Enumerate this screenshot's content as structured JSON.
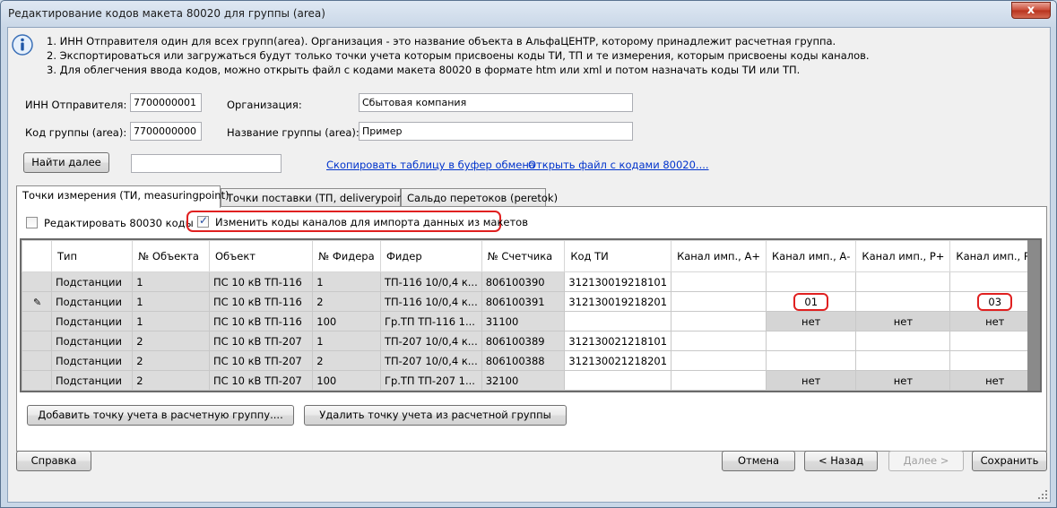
{
  "window": {
    "title": "Редактирование кодов макета 80020 для группы (area)",
    "close_glyph": "x"
  },
  "info": {
    "line1": "1. ИНН Отправителя один для всех групп(area). Организация - это название объекта в АльфаЦЕНТР, которому принадлежит расчетная группа.",
    "line2": "2. Экспортироваться или загружаться будут только точки учета которым присвоены коды ТИ, ТП и те измерения, которым присвоены коды каналов.",
    "line3": "3. Для облегчения ввода кодов, можно открыть файл с кодами макета 80020 в формате htm или xml и потом назначать коды ТИ или ТП."
  },
  "form": {
    "inn_label": "ИНН Отправителя:",
    "inn_value": "7700000001",
    "org_label": "Организация:",
    "org_value": "Сбытовая компания",
    "group_code_label": "Код группы (area):",
    "group_code_value": "7700000000",
    "group_name_label": "Название группы (area):",
    "group_name_value": "Пример",
    "find_next_label": "Найти далее",
    "find_value": "",
    "copy_link": "Скопировать таблицу в буфер обмена",
    "open_link": "Открыть файл с кодами 80020...."
  },
  "tabs": [
    {
      "label": "Точки измерения (ТИ, measuringpoint)",
      "active": true
    },
    {
      "label": "Точки поставки (ТП, deliverypoint)",
      "active": false
    },
    {
      "label": "Сальдо перетоков (peretok)",
      "active": false
    }
  ],
  "options": {
    "edit80030_label": "Редактировать 80030 коды",
    "edit80030_checked": false,
    "change_codes_label": "Изменить коды каналов для импорта данных из макетов",
    "change_codes_checked": true
  },
  "grid": {
    "columns": [
      "Тип",
      "№ Объекта",
      "Объект",
      "№ Фидера",
      "Фидер",
      "№ Счетчика",
      "Код ТИ",
      "Канал имп., А+",
      "Канал имп., А-",
      "Канал имп., Р+",
      "Канал имп., Р-"
    ],
    "editing_glyph": "✎",
    "rows": [
      {
        "editing": false,
        "cells": [
          "Подстанции",
          "1",
          "ПС 10 кВ ТП-116",
          "1",
          "ТП-116 10/0,4 к...",
          "806100390",
          "312130019218101",
          "",
          "",
          "",
          ""
        ]
      },
      {
        "editing": true,
        "cells": [
          "Подстанции",
          "1",
          "ПС 10 кВ ТП-116",
          "2",
          "ТП-116 10/0,4 к...",
          "806100391",
          "312130019218201",
          "",
          "01",
          "",
          "03"
        ]
      },
      {
        "editing": false,
        "cells": [
          "Подстанции",
          "1",
          "ПС 10 кВ ТП-116",
          "100",
          "Гр.ТП ТП-116 1...",
          "31100",
          "",
          "",
          "нет",
          "нет",
          "нет"
        ]
      },
      {
        "editing": false,
        "cells": [
          "Подстанции",
          "2",
          "ПС 10 кВ ТП-207",
          "1",
          "ТП-207 10/0,4 к...",
          "806100389",
          "312130021218101",
          "",
          "",
          "",
          ""
        ]
      },
      {
        "editing": false,
        "cells": [
          "Подстанции",
          "2",
          "ПС 10 кВ ТП-207",
          "2",
          "ТП-207 10/0,4 к...",
          "806100388",
          "312130021218201",
          "",
          "",
          "",
          ""
        ]
      },
      {
        "editing": false,
        "cells": [
          "Подстанции",
          "2",
          "ПС 10 кВ ТП-207",
          "100",
          "Гр.ТП ТП-207 1...",
          "32100",
          "",
          "",
          "нет",
          "нет",
          "нет"
        ]
      }
    ]
  },
  "actions": {
    "add_label": "Добавить точку учета в расчетную группу....",
    "remove_label": "Удалить точку учета из расчетной группы"
  },
  "footer": {
    "help_label": "Справка",
    "cancel_label": "Отмена",
    "back_label": "< Назад",
    "next_label": "Далее >",
    "save_label": "Сохранить"
  },
  "colors": {
    "highlight": "#e02020",
    "link": "#0033cc"
  }
}
